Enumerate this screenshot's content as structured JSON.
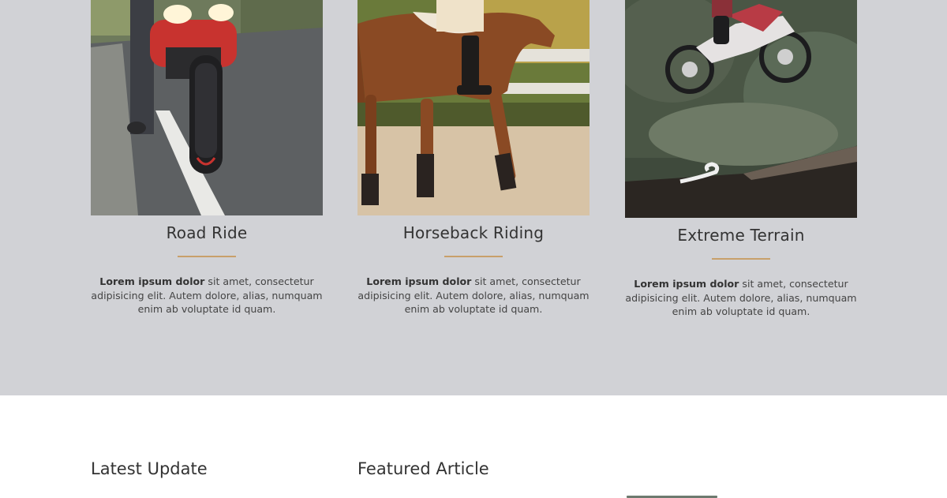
{
  "features": {
    "background": "#d1d2d6",
    "accent": "#c8a06a",
    "cards": [
      {
        "title": "Road Ride",
        "image": "motorcycle-on-road-photo",
        "body_bold": "Lorem ipsum dolor",
        "body_rest": " sit amet, consectetur adipisicing elit. Autem dolore, alias, numquam enim ab voluptate id quam."
      },
      {
        "title": "Horseback Riding",
        "image": "horse-and-rider-photo",
        "body_bold": "Lorem ipsum dolor",
        "body_rest": " sit amet, consectetur adipisicing elit. Autem dolore, alias, numquam enim ab voluptate id quam."
      },
      {
        "title": "Extreme Terrain",
        "image": "dirt-bike-jump-photo",
        "body_bold": "Lorem ipsum dolor",
        "body_rest": " sit amet, consectetur adipisicing elit. Autem dolore, alias, numquam enim ab voluptate id quam."
      }
    ]
  },
  "lower": {
    "latest_heading": "Latest Update",
    "featured_heading": "Featured Article"
  }
}
